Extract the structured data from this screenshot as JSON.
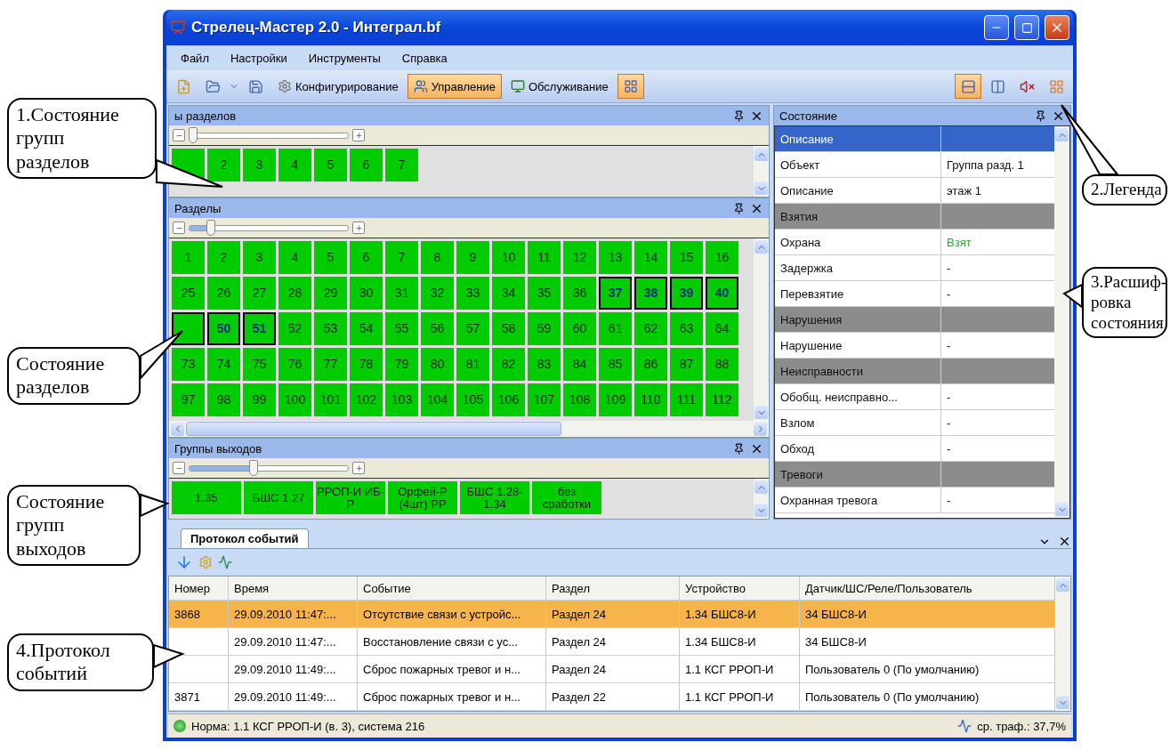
{
  "window": {
    "title": "Стрелец-Мастер 2.0 - Интеграл.bf"
  },
  "menu": [
    "Файл",
    "Настройки",
    "Инструменты",
    "Справка"
  ],
  "toolbar": {
    "modes": [
      {
        "label": "Конфигурирование",
        "selected": false,
        "kind": "config"
      },
      {
        "label": "Управление",
        "selected": true,
        "kind": "control"
      },
      {
        "label": "Обслуживание",
        "selected": false,
        "kind": "service"
      }
    ],
    "layouts": [
      {
        "selected": true
      },
      {
        "selected": false
      }
    ]
  },
  "groups_panel": {
    "title": "ы разделов",
    "slider": {
      "level": 0.0
    },
    "cells": [
      {
        "highlighted": false
      },
      {
        "label": "2",
        "highlighted": false
      },
      {
        "label": "3",
        "highlighted": false
      },
      {
        "label": "4",
        "highlighted": false
      },
      {
        "label": "5",
        "highlighted": false
      },
      {
        "label": "6",
        "highlighted": false
      },
      {
        "label": "7",
        "highlighted": false
      }
    ]
  },
  "sections_panel": {
    "title": "Разделы",
    "slider": {
      "level": 0.12
    },
    "rows": [
      [
        "1",
        "2",
        "3",
        "4",
        "5",
        "6",
        "7",
        "8",
        "9",
        "10",
        "11",
        "12",
        "13",
        "14",
        "15",
        "16"
      ],
      [
        "25",
        "26",
        "27",
        "28",
        "29",
        "30",
        "31",
        "32",
        "33",
        "34",
        "35",
        "36",
        {
          "label": "37",
          "highlighted": true
        },
        {
          "label": "38",
          "highlighted": true
        },
        {
          "label": "39",
          "highlighted": true
        },
        {
          "label": "40",
          "highlighted": true
        }
      ],
      [
        {
          "highlighted": true
        },
        {
          "label": "50",
          "highlighted": true
        },
        {
          "label": "51",
          "highlighted": true
        },
        "52",
        "53",
        "54",
        "55",
        "56",
        "57",
        "58",
        "59",
        "60",
        "61",
        "62",
        "63",
        "64"
      ],
      [
        "73",
        "74",
        "75",
        "76",
        "77",
        "78",
        "79",
        "80",
        "81",
        "82",
        "83",
        "84",
        "85",
        "86",
        "87",
        "88"
      ],
      [
        "97",
        "98",
        "99",
        "100",
        "101",
        "102",
        "103",
        "104",
        "105",
        "106",
        "107",
        "108",
        "109",
        "110",
        "111",
        "112"
      ]
    ]
  },
  "outputs_panel": {
    "title": "Группы выходов",
    "slider": {
      "level": 0.4
    },
    "cells": [
      "1.35",
      "БШС 1.27",
      "РРОП-И ИБ-Р",
      "Орфей-Р (4шт) РР",
      "БШС 1.28-1.34",
      "без сработки"
    ]
  },
  "state_panel": {
    "title": "Состояние",
    "rows": [
      {
        "kind": "category",
        "name": "Описание",
        "selected": true
      },
      {
        "kind": "property",
        "name": "Объект",
        "value": "Группа разд. 1"
      },
      {
        "kind": "property",
        "name": "Описание",
        "value": "этаж 1"
      },
      {
        "kind": "category",
        "name": "Взятия",
        "selected": false
      },
      {
        "kind": "property",
        "name": "Охрана",
        "value": "Взят",
        "color": "#2fa82f"
      },
      {
        "kind": "property",
        "name": "Задержка",
        "value": "-"
      },
      {
        "kind": "property",
        "name": "Перевзятие",
        "value": "-"
      },
      {
        "kind": "category",
        "name": "Нарушения",
        "selected": false
      },
      {
        "kind": "property",
        "name": "Нарушение",
        "value": "-"
      },
      {
        "kind": "category",
        "name": "Неисправности",
        "selected": false
      },
      {
        "kind": "property",
        "name": "Обобщ. неисправно...",
        "value": "-"
      },
      {
        "kind": "property",
        "name": "Взлом",
        "value": "-"
      },
      {
        "kind": "property",
        "name": "Обход",
        "value": "-"
      },
      {
        "kind": "category",
        "name": "Тревоги",
        "selected": false
      },
      {
        "kind": "property",
        "name": "Охранная тревога",
        "value": "-"
      }
    ]
  },
  "event_log": {
    "tab": "Протокол событий",
    "columns": [
      "Номер",
      "Время",
      "Событие",
      "Раздел",
      "Устройство",
      "Датчик/ШС/Реле/Пользователь"
    ],
    "rows": [
      {
        "selected": true,
        "cells": [
          "3868",
          "29.09.2010 11:47:...",
          "Отсутствие связи с устройс...",
          "Раздел 24",
          "1.34 БШС8-И",
          "34 БШС8-И"
        ]
      },
      {
        "selected": false,
        "cells": [
          null,
          "29.09.2010 11:47:...",
          "Восстановление связи  с ус...",
          "Раздел 24",
          "1.34 БШС8-И",
          "34 БШС8-И"
        ]
      },
      {
        "selected": false,
        "cells": [
          null,
          "29.09.2010 11:49:...",
          "Сброс пожарных тревог и н...",
          "Раздел 24",
          "1.1 КСГ РРОП-И",
          "Пользователь 0 (По умолчанию)"
        ]
      },
      {
        "selected": false,
        "cells": [
          "3871",
          "29.09.2010 11:49:...",
          "Сброс пожарных тревог и н...",
          "Раздел 22",
          "1.1 КСГ РРОП-И",
          "Пользователь 0 (По умолчанию)"
        ]
      }
    ]
  },
  "status_bar": {
    "message": "Норма: 1.1 КСГ РРОП-И (в. 3), система 216",
    "traffic": "ср. траф.: 37,7%"
  },
  "callouts": [
    {
      "lines": [
        "1.Состояние",
        "групп",
        "разделов"
      ]
    },
    {
      "lines": [
        "2.Легенда"
      ]
    },
    {
      "lines": [
        "3.Расшиф-",
        "ровка",
        "состояния"
      ]
    },
    {
      "lines": [
        "Состояние",
        "разделов"
      ]
    },
    {
      "lines": [
        "Состояние",
        "групп",
        "выходов"
      ]
    },
    {
      "lines": [
        "4.Протокол",
        "событий"
      ]
    }
  ]
}
